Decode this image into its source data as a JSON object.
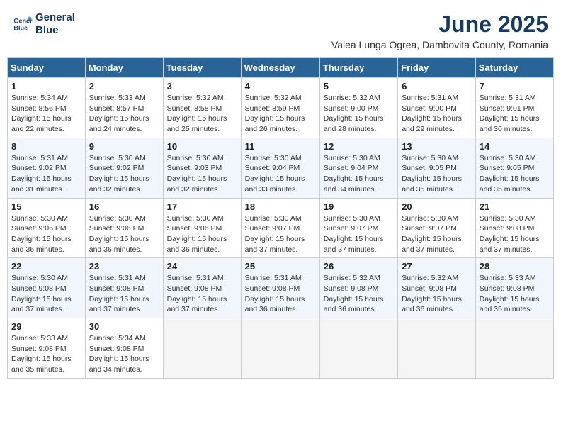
{
  "header": {
    "logo_line1": "General",
    "logo_line2": "Blue",
    "title": "June 2025",
    "subtitle": "Valea Lunga Ogrea, Dambovita County, Romania"
  },
  "weekdays": [
    "Sunday",
    "Monday",
    "Tuesday",
    "Wednesday",
    "Thursday",
    "Friday",
    "Saturday"
  ],
  "weeks": [
    [
      {
        "day": 1,
        "sunrise": "5:34 AM",
        "sunset": "8:56 PM",
        "daylight": "15 hours and 22 minutes."
      },
      {
        "day": 2,
        "sunrise": "5:33 AM",
        "sunset": "8:57 PM",
        "daylight": "15 hours and 24 minutes."
      },
      {
        "day": 3,
        "sunrise": "5:32 AM",
        "sunset": "8:58 PM",
        "daylight": "15 hours and 25 minutes."
      },
      {
        "day": 4,
        "sunrise": "5:32 AM",
        "sunset": "8:59 PM",
        "daylight": "15 hours and 26 minutes."
      },
      {
        "day": 5,
        "sunrise": "5:32 AM",
        "sunset": "9:00 PM",
        "daylight": "15 hours and 28 minutes."
      },
      {
        "day": 6,
        "sunrise": "5:31 AM",
        "sunset": "9:00 PM",
        "daylight": "15 hours and 29 minutes."
      },
      {
        "day": 7,
        "sunrise": "5:31 AM",
        "sunset": "9:01 PM",
        "daylight": "15 hours and 30 minutes."
      }
    ],
    [
      {
        "day": 8,
        "sunrise": "5:31 AM",
        "sunset": "9:02 PM",
        "daylight": "15 hours and 31 minutes."
      },
      {
        "day": 9,
        "sunrise": "5:30 AM",
        "sunset": "9:02 PM",
        "daylight": "15 hours and 32 minutes."
      },
      {
        "day": 10,
        "sunrise": "5:30 AM",
        "sunset": "9:03 PM",
        "daylight": "15 hours and 32 minutes."
      },
      {
        "day": 11,
        "sunrise": "5:30 AM",
        "sunset": "9:04 PM",
        "daylight": "15 hours and 33 minutes."
      },
      {
        "day": 12,
        "sunrise": "5:30 AM",
        "sunset": "9:04 PM",
        "daylight": "15 hours and 34 minutes."
      },
      {
        "day": 13,
        "sunrise": "5:30 AM",
        "sunset": "9:05 PM",
        "daylight": "15 hours and 35 minutes."
      },
      {
        "day": 14,
        "sunrise": "5:30 AM",
        "sunset": "9:05 PM",
        "daylight": "15 hours and 35 minutes."
      }
    ],
    [
      {
        "day": 15,
        "sunrise": "5:30 AM",
        "sunset": "9:06 PM",
        "daylight": "15 hours and 36 minutes."
      },
      {
        "day": 16,
        "sunrise": "5:30 AM",
        "sunset": "9:06 PM",
        "daylight": "15 hours and 36 minutes."
      },
      {
        "day": 17,
        "sunrise": "5:30 AM",
        "sunset": "9:06 PM",
        "daylight": "15 hours and 36 minutes."
      },
      {
        "day": 18,
        "sunrise": "5:30 AM",
        "sunset": "9:07 PM",
        "daylight": "15 hours and 37 minutes."
      },
      {
        "day": 19,
        "sunrise": "5:30 AM",
        "sunset": "9:07 PM",
        "daylight": "15 hours and 37 minutes."
      },
      {
        "day": 20,
        "sunrise": "5:30 AM",
        "sunset": "9:07 PM",
        "daylight": "15 hours and 37 minutes."
      },
      {
        "day": 21,
        "sunrise": "5:30 AM",
        "sunset": "9:08 PM",
        "daylight": "15 hours and 37 minutes."
      }
    ],
    [
      {
        "day": 22,
        "sunrise": "5:30 AM",
        "sunset": "9:08 PM",
        "daylight": "15 hours and 37 minutes."
      },
      {
        "day": 23,
        "sunrise": "5:31 AM",
        "sunset": "9:08 PM",
        "daylight": "15 hours and 37 minutes."
      },
      {
        "day": 24,
        "sunrise": "5:31 AM",
        "sunset": "9:08 PM",
        "daylight": "15 hours and 37 minutes."
      },
      {
        "day": 25,
        "sunrise": "5:31 AM",
        "sunset": "9:08 PM",
        "daylight": "15 hours and 36 minutes."
      },
      {
        "day": 26,
        "sunrise": "5:32 AM",
        "sunset": "9:08 PM",
        "daylight": "15 hours and 36 minutes."
      },
      {
        "day": 27,
        "sunrise": "5:32 AM",
        "sunset": "9:08 PM",
        "daylight": "15 hours and 36 minutes."
      },
      {
        "day": 28,
        "sunrise": "5:33 AM",
        "sunset": "9:08 PM",
        "daylight": "15 hours and 35 minutes."
      }
    ],
    [
      {
        "day": 29,
        "sunrise": "5:33 AM",
        "sunset": "9:08 PM",
        "daylight": "15 hours and 35 minutes."
      },
      {
        "day": 30,
        "sunrise": "5:34 AM",
        "sunset": "9:08 PM",
        "daylight": "15 hours and 34 minutes."
      },
      null,
      null,
      null,
      null,
      null
    ]
  ]
}
